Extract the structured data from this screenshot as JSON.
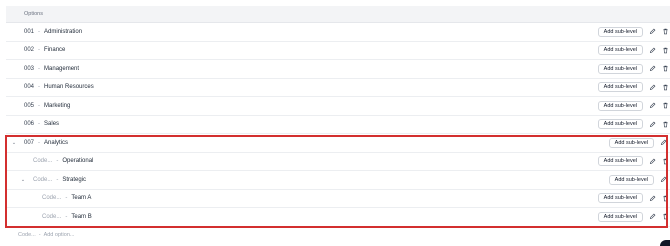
{
  "header": {
    "title": "Options"
  },
  "buttons": {
    "add_sub_level": "Add sub-level"
  },
  "rows": [
    {
      "code": "001",
      "name": "Administration"
    },
    {
      "code": "002",
      "name": "Finance"
    },
    {
      "code": "003",
      "name": "Management"
    },
    {
      "code": "004",
      "name": "Human Resources"
    },
    {
      "code": "005",
      "name": "Marketing"
    },
    {
      "code": "006",
      "name": "Sales"
    },
    {
      "code": "007",
      "name": "Analytics"
    },
    {
      "code": "Code...",
      "name": "Operational"
    },
    {
      "code": "Code...",
      "name": "Strategic"
    },
    {
      "code": "Code...",
      "name": "Team A"
    },
    {
      "code": "Code...",
      "name": "Team B"
    }
  ],
  "add_option": {
    "code_placeholder": "Code...",
    "name_placeholder": "Add option..."
  },
  "separator": "-",
  "colors": {
    "highlight": "#d32f2f",
    "header_bg": "#f3f4f6"
  },
  "icons": {
    "edit": "pencil-icon",
    "delete": "trash-icon",
    "expand": "chevron-down-icon"
  }
}
